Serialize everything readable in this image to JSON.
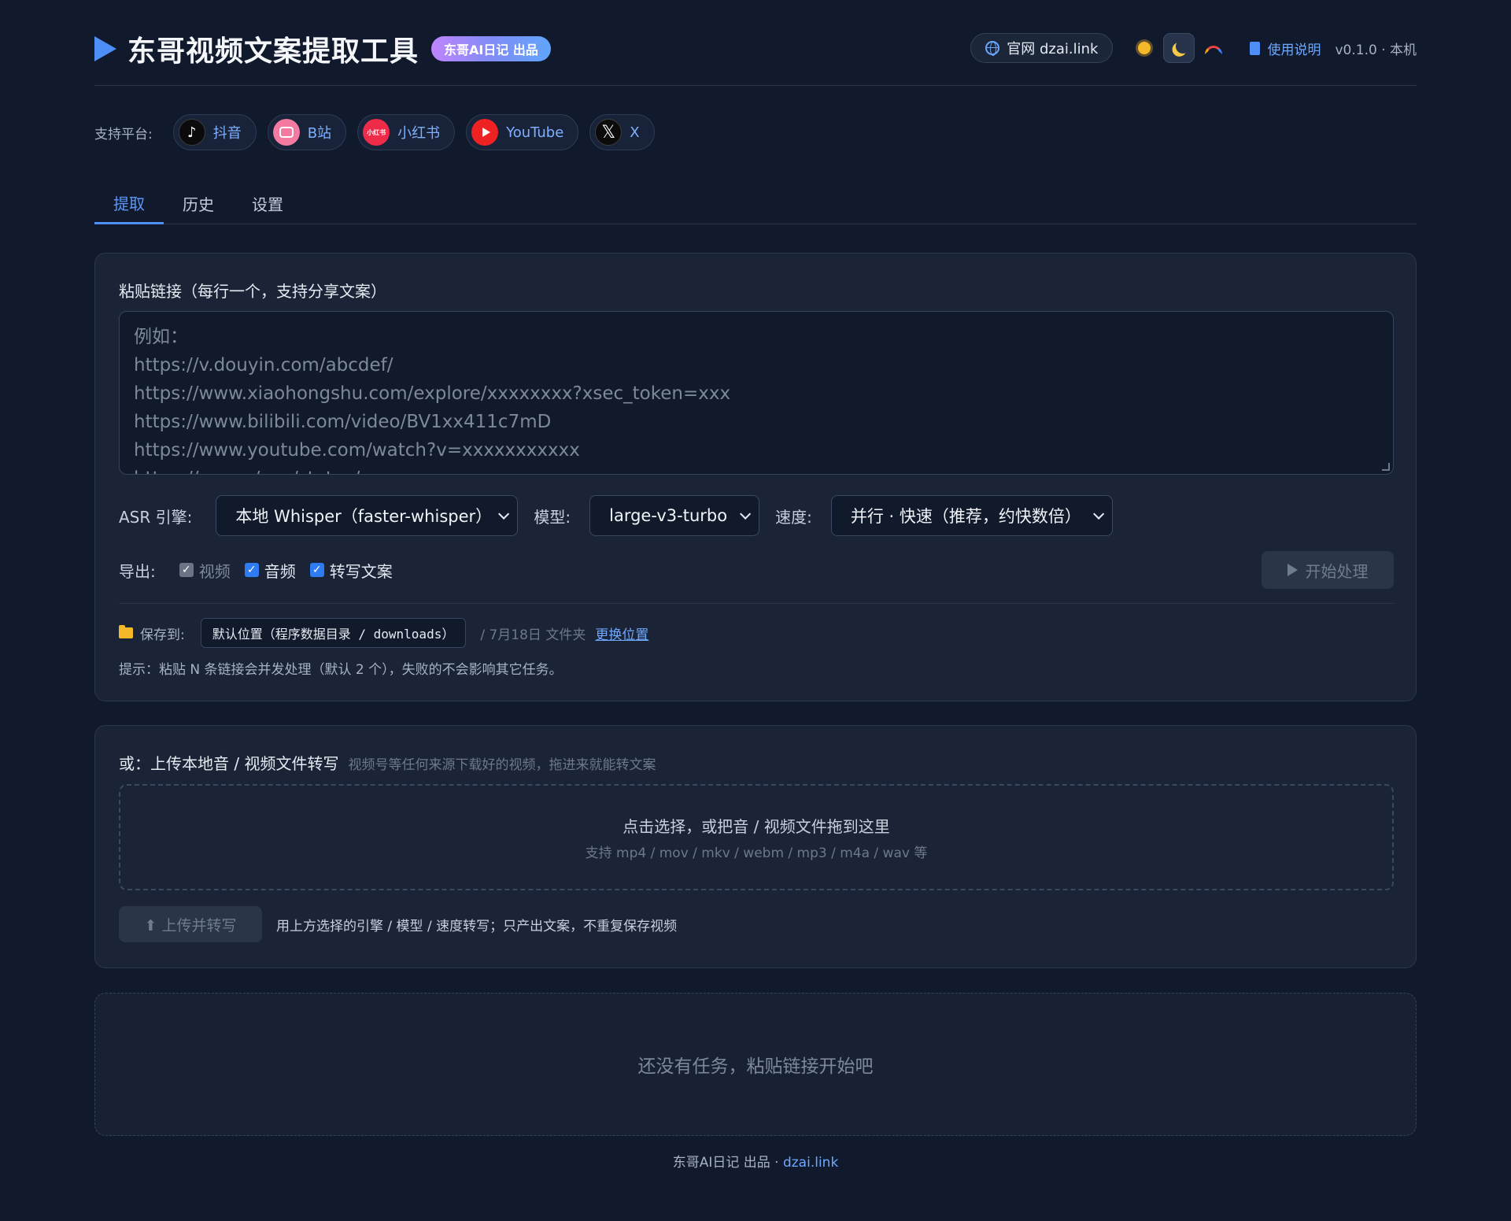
{
  "header": {
    "title": "东哥视频文案提取工具",
    "badge": "东哥AI日记 出品",
    "site_link": "官网 dzai.link",
    "doc_link": "使用说明",
    "version": "v0.1.0 · 本机",
    "theme": {
      "options": [
        "sun-icon",
        "moon-icon",
        "rainbow-icon"
      ],
      "active": "moon"
    }
  },
  "platforms": {
    "label": "支持平台:",
    "items": [
      {
        "label": "抖音",
        "icon": "douyin-icon"
      },
      {
        "label": "B站",
        "icon": "bilibili-icon"
      },
      {
        "label": "小红书",
        "icon": "xiaohongshu-icon",
        "icon_text": "小红书"
      },
      {
        "label": "YouTube",
        "icon": "youtube-icon"
      },
      {
        "label": "X",
        "icon": "x-icon"
      }
    ]
  },
  "tabs": [
    {
      "label": "提取",
      "active": true
    },
    {
      "label": "历史",
      "active": false
    },
    {
      "label": "设置",
      "active": false
    }
  ],
  "extract": {
    "paste_label": "粘贴链接（每行一个，支持分享文案）",
    "placeholder": "例如：\nhttps://v.douyin.com/abcdef/\nhttps://www.xiaohongshu.com/explore/xxxxxxxx?xsec_token=xxx\nhttps://www.bilibili.com/video/BV1xx411c7mD\nhttps://www.youtube.com/watch?v=xxxxxxxxxxx\nhttps://x.com/xxx/status/xxx",
    "asr_label": "ASR 引擎:",
    "asr_value": "本地 Whisper（faster-whisper）",
    "model_label": "模型:",
    "model_value": "large-v3-turbo",
    "speed_label": "速度:",
    "speed_value": "并行 · 快速（推荐，约快数倍）",
    "export_label": "导出:",
    "export_options": [
      {
        "label": "视频",
        "checked": true,
        "disabled": true
      },
      {
        "label": "音频",
        "checked": true,
        "disabled": false
      },
      {
        "label": "转写文案",
        "checked": true,
        "disabled": false
      }
    ],
    "start_button": "开始处理",
    "save_label": "保存到:",
    "save_path": "默认位置（程序数据目录 / downloads）",
    "save_suffix": "/ 7月18日 文件夹",
    "change_location": "更换位置",
    "tip": "提示：粘贴 N 条链接会并发处理（默认 2 个），失败的不会影响其它任务。"
  },
  "upload": {
    "title": "或：上传本地音 / 视频文件转写",
    "subtitle": "视频号等任何来源下载好的视频，拖进来就能转文案",
    "drop_main": "点击选择，或把音 / 视频文件拖到这里",
    "drop_sub": "支持 mp4 / mov / mkv / webm / mp3 / m4a / wav 等",
    "button": "⬆ 上传并转写",
    "note": "用上方选择的引擎 / 模型 / 速度转写；只产出文案，不重复保存视频"
  },
  "tasks": {
    "empty": "还没有任务，粘贴链接开始吧"
  },
  "footer": {
    "text": "东哥AI日记 出品 · ",
    "link": "dzai.link"
  }
}
